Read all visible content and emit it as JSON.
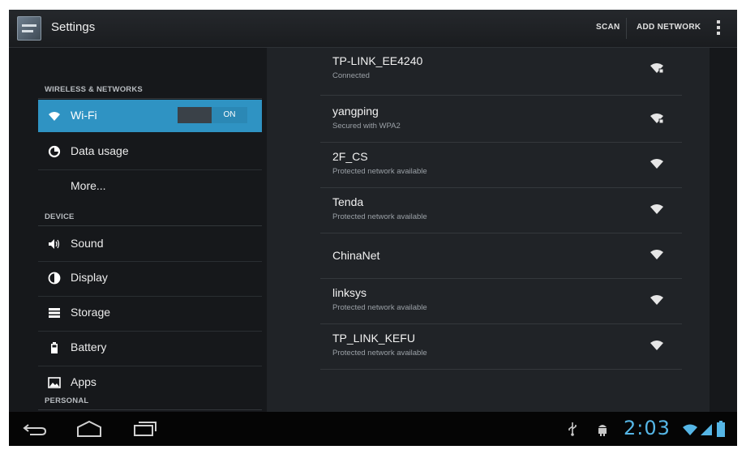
{
  "actionbar": {
    "title": "Settings",
    "scan_label": "SCAN",
    "add_network_label": "ADD NETWORK",
    "app_icon": "settings-app-icon",
    "overflow_icon": "overflow-menu-icon"
  },
  "sidebar": {
    "sections": [
      {
        "header": "WIRELESS & NETWORKS",
        "items": [
          {
            "label": "Wi-Fi",
            "icon": "wifi-icon",
            "active": true,
            "toggle": "ON"
          },
          {
            "label": "Data usage",
            "icon": "data-usage-icon"
          },
          {
            "label": "More...",
            "icon": ""
          }
        ]
      },
      {
        "header": "DEVICE",
        "items": [
          {
            "label": "Sound",
            "icon": "sound-icon"
          },
          {
            "label": "Display",
            "icon": "display-icon"
          },
          {
            "label": "Storage",
            "icon": "storage-icon"
          },
          {
            "label": "Battery",
            "icon": "battery-icon"
          },
          {
            "label": "Apps",
            "icon": "apps-icon"
          }
        ]
      },
      {
        "header": "PERSONAL",
        "items": []
      }
    ]
  },
  "networks": [
    {
      "ssid": "TP-LINK_EE4240",
      "status": "Connected",
      "icon": "wifi-locked-signal-icon"
    },
    {
      "ssid": "yangping",
      "status": "Secured with WPA2",
      "icon": "wifi-locked-signal-icon"
    },
    {
      "ssid": "2F_CS",
      "status": "Protected network available",
      "icon": "wifi-signal-icon"
    },
    {
      "ssid": "Tenda",
      "status": "Protected network available",
      "icon": "wifi-signal-icon"
    },
    {
      "ssid": "ChinaNet",
      "status": "",
      "icon": "wifi-signal-icon"
    },
    {
      "ssid": "linksys",
      "status": "Protected network available",
      "icon": "wifi-signal-icon"
    },
    {
      "ssid": "TP_LINK_KEFU",
      "status": "Protected network available",
      "icon": "wifi-signal-icon"
    }
  ],
  "navbar": {
    "back_icon": "back-icon",
    "home_icon": "home-icon",
    "recents_icon": "recent-apps-icon",
    "usb_icon": "usb-icon",
    "android_icon": "android-debug-icon",
    "time": "2:03",
    "wifi_status_icon": "wifi-status-icon",
    "signal_icon": "signal-icon",
    "battery_icon": "battery-status-icon"
  },
  "colors": {
    "accent": "#2f93c3",
    "clock": "#55b6e6",
    "background": "#16181b",
    "panel": "#202327"
  }
}
